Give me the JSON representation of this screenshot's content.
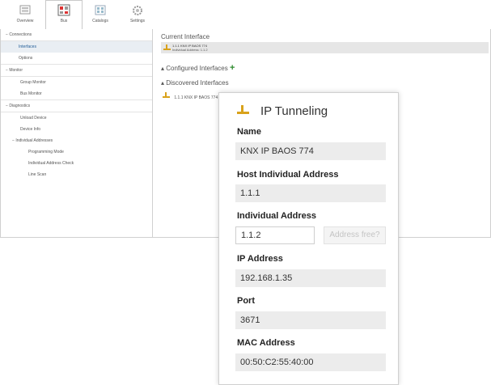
{
  "toolbar": {
    "items": [
      {
        "label": "Overview",
        "icon": "overview-icon"
      },
      {
        "label": "Bus",
        "icon": "bus-icon"
      },
      {
        "label": "Catalogs",
        "icon": "catalogs-icon"
      },
      {
        "label": "Settings",
        "icon": "settings-icon"
      }
    ]
  },
  "sidebar": {
    "connections": "Connections",
    "interfaces": "Interfaces",
    "options": "Options",
    "monitor": "Monitor",
    "group_monitor": "Group Monitor",
    "bus_monitor": "Bus Monitor",
    "diagnostics": "Diagnostics",
    "unload_device": "Unload Device",
    "device_info": "Device Info",
    "individual_addresses": "Individual Addresses",
    "programming_mode": "Programming Mode",
    "individual_address_check": "Individual Address Check",
    "line_scan": "Line Scan"
  },
  "main": {
    "current_interface": "Current Interface",
    "current_line1": "1.1.1 KNX IP BAOS 774",
    "current_line2": "Individual Address: 1.1.2",
    "configured": "Configured Interfaces",
    "discovered": "Discovered Interfaces",
    "discovered_item": "1.1.1 KNX IP BAOS 774"
  },
  "dialog": {
    "title": "IP Tunneling",
    "name_label": "Name",
    "name_value": "KNX IP BAOS 774",
    "host_label": "Host Individual Address",
    "host_value": "1.1.1",
    "indiv_label": "Individual Address",
    "indiv_value": "1.1.2",
    "address_free_button": "Address free?",
    "ip_label": "IP Address",
    "ip_value": "192.168.1.35",
    "port_label": "Port",
    "port_value": "3671",
    "mac_label": "MAC Address",
    "mac_value": "00:50:C2:55:40:00"
  },
  "colors": {
    "accent": "#1e5a96",
    "plus_green": "#2e8b2e",
    "field_bg": "#ececec",
    "interface_icon": "#d9a21b"
  }
}
